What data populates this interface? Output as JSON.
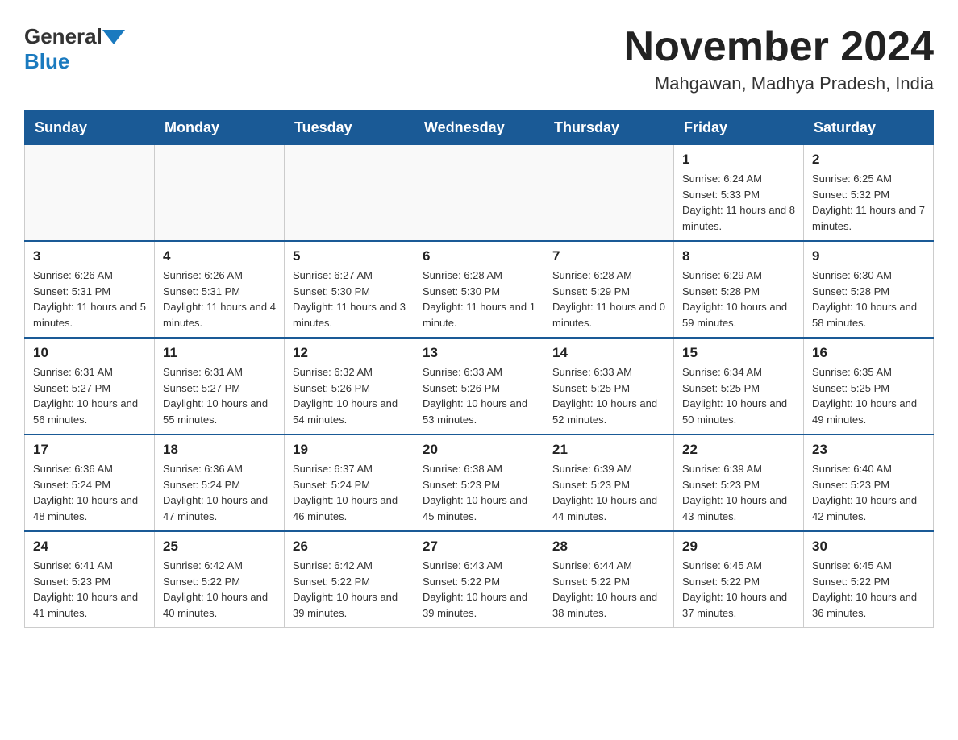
{
  "logo": {
    "general": "General",
    "blue": "Blue"
  },
  "title": "November 2024",
  "location": "Mahgawan, Madhya Pradesh, India",
  "headers": [
    "Sunday",
    "Monday",
    "Tuesday",
    "Wednesday",
    "Thursday",
    "Friday",
    "Saturday"
  ],
  "weeks": [
    [
      {
        "day": "",
        "info": ""
      },
      {
        "day": "",
        "info": ""
      },
      {
        "day": "",
        "info": ""
      },
      {
        "day": "",
        "info": ""
      },
      {
        "day": "",
        "info": ""
      },
      {
        "day": "1",
        "info": "Sunrise: 6:24 AM\nSunset: 5:33 PM\nDaylight: 11 hours and 8 minutes."
      },
      {
        "day": "2",
        "info": "Sunrise: 6:25 AM\nSunset: 5:32 PM\nDaylight: 11 hours and 7 minutes."
      }
    ],
    [
      {
        "day": "3",
        "info": "Sunrise: 6:26 AM\nSunset: 5:31 PM\nDaylight: 11 hours and 5 minutes."
      },
      {
        "day": "4",
        "info": "Sunrise: 6:26 AM\nSunset: 5:31 PM\nDaylight: 11 hours and 4 minutes."
      },
      {
        "day": "5",
        "info": "Sunrise: 6:27 AM\nSunset: 5:30 PM\nDaylight: 11 hours and 3 minutes."
      },
      {
        "day": "6",
        "info": "Sunrise: 6:28 AM\nSunset: 5:30 PM\nDaylight: 11 hours and 1 minute."
      },
      {
        "day": "7",
        "info": "Sunrise: 6:28 AM\nSunset: 5:29 PM\nDaylight: 11 hours and 0 minutes."
      },
      {
        "day": "8",
        "info": "Sunrise: 6:29 AM\nSunset: 5:28 PM\nDaylight: 10 hours and 59 minutes."
      },
      {
        "day": "9",
        "info": "Sunrise: 6:30 AM\nSunset: 5:28 PM\nDaylight: 10 hours and 58 minutes."
      }
    ],
    [
      {
        "day": "10",
        "info": "Sunrise: 6:31 AM\nSunset: 5:27 PM\nDaylight: 10 hours and 56 minutes."
      },
      {
        "day": "11",
        "info": "Sunrise: 6:31 AM\nSunset: 5:27 PM\nDaylight: 10 hours and 55 minutes."
      },
      {
        "day": "12",
        "info": "Sunrise: 6:32 AM\nSunset: 5:26 PM\nDaylight: 10 hours and 54 minutes."
      },
      {
        "day": "13",
        "info": "Sunrise: 6:33 AM\nSunset: 5:26 PM\nDaylight: 10 hours and 53 minutes."
      },
      {
        "day": "14",
        "info": "Sunrise: 6:33 AM\nSunset: 5:25 PM\nDaylight: 10 hours and 52 minutes."
      },
      {
        "day": "15",
        "info": "Sunrise: 6:34 AM\nSunset: 5:25 PM\nDaylight: 10 hours and 50 minutes."
      },
      {
        "day": "16",
        "info": "Sunrise: 6:35 AM\nSunset: 5:25 PM\nDaylight: 10 hours and 49 minutes."
      }
    ],
    [
      {
        "day": "17",
        "info": "Sunrise: 6:36 AM\nSunset: 5:24 PM\nDaylight: 10 hours and 48 minutes."
      },
      {
        "day": "18",
        "info": "Sunrise: 6:36 AM\nSunset: 5:24 PM\nDaylight: 10 hours and 47 minutes."
      },
      {
        "day": "19",
        "info": "Sunrise: 6:37 AM\nSunset: 5:24 PM\nDaylight: 10 hours and 46 minutes."
      },
      {
        "day": "20",
        "info": "Sunrise: 6:38 AM\nSunset: 5:23 PM\nDaylight: 10 hours and 45 minutes."
      },
      {
        "day": "21",
        "info": "Sunrise: 6:39 AM\nSunset: 5:23 PM\nDaylight: 10 hours and 44 minutes."
      },
      {
        "day": "22",
        "info": "Sunrise: 6:39 AM\nSunset: 5:23 PM\nDaylight: 10 hours and 43 minutes."
      },
      {
        "day": "23",
        "info": "Sunrise: 6:40 AM\nSunset: 5:23 PM\nDaylight: 10 hours and 42 minutes."
      }
    ],
    [
      {
        "day": "24",
        "info": "Sunrise: 6:41 AM\nSunset: 5:23 PM\nDaylight: 10 hours and 41 minutes."
      },
      {
        "day": "25",
        "info": "Sunrise: 6:42 AM\nSunset: 5:22 PM\nDaylight: 10 hours and 40 minutes."
      },
      {
        "day": "26",
        "info": "Sunrise: 6:42 AM\nSunset: 5:22 PM\nDaylight: 10 hours and 39 minutes."
      },
      {
        "day": "27",
        "info": "Sunrise: 6:43 AM\nSunset: 5:22 PM\nDaylight: 10 hours and 39 minutes."
      },
      {
        "day": "28",
        "info": "Sunrise: 6:44 AM\nSunset: 5:22 PM\nDaylight: 10 hours and 38 minutes."
      },
      {
        "day": "29",
        "info": "Sunrise: 6:45 AM\nSunset: 5:22 PM\nDaylight: 10 hours and 37 minutes."
      },
      {
        "day": "30",
        "info": "Sunrise: 6:45 AM\nSunset: 5:22 PM\nDaylight: 10 hours and 36 minutes."
      }
    ]
  ]
}
